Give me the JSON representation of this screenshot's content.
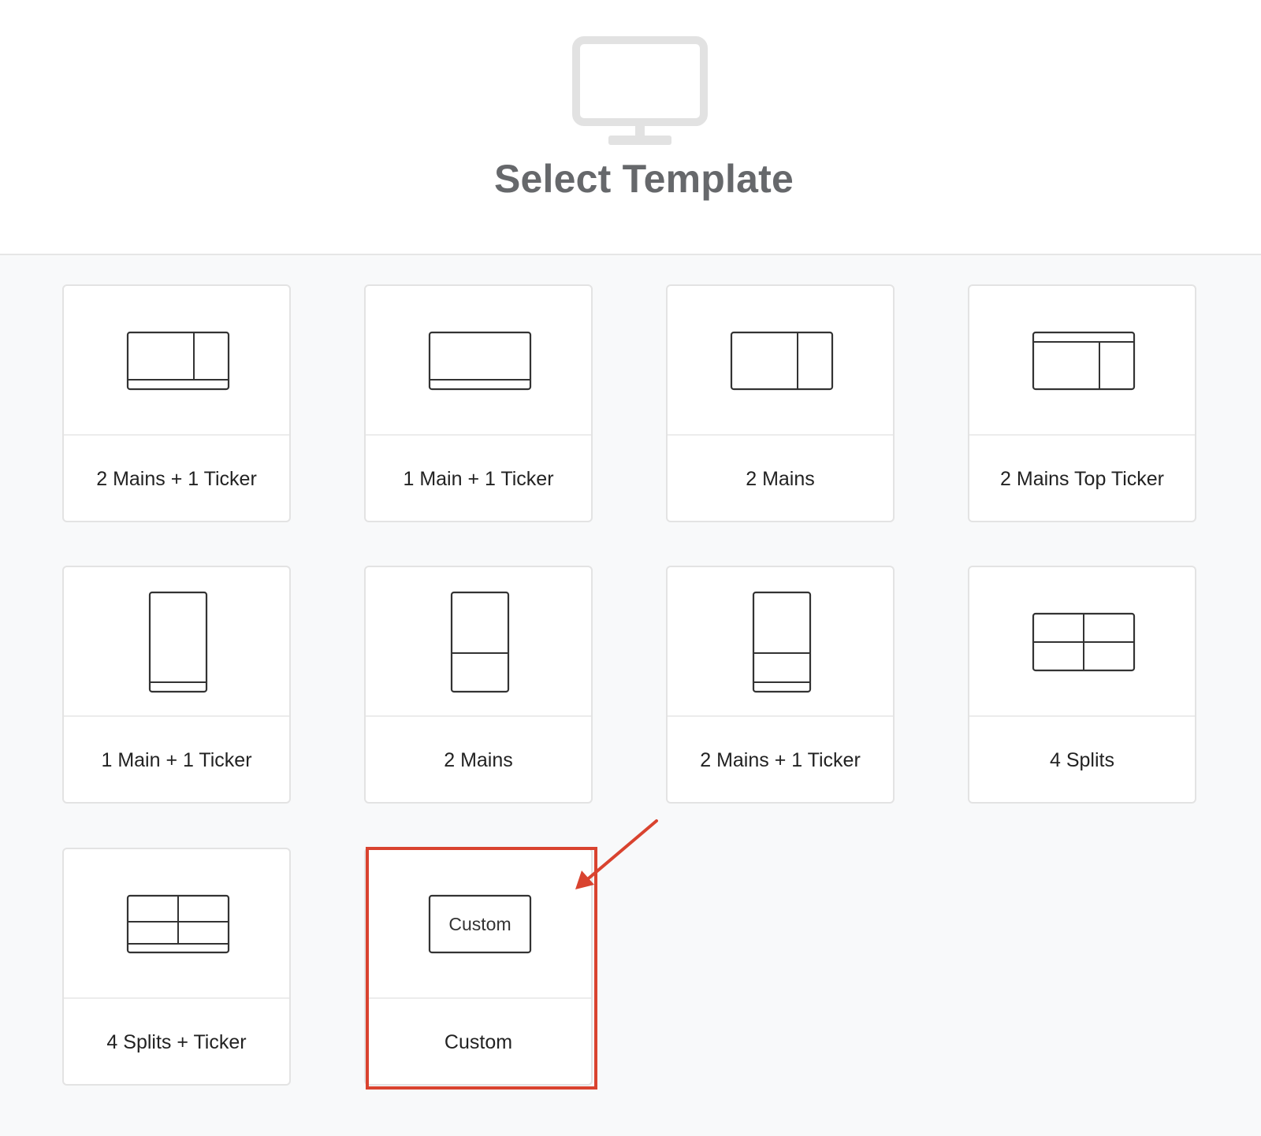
{
  "header": {
    "title": "Select Template",
    "icon": "monitor-icon"
  },
  "templates": [
    {
      "label": "2 Mains + 1 Ticker",
      "icon": "layout-2mains-ticker-landscape-icon"
    },
    {
      "label": "1 Main + 1 Ticker",
      "icon": "layout-1main-ticker-landscape-icon"
    },
    {
      "label": "2 Mains",
      "icon": "layout-2mains-landscape-icon"
    },
    {
      "label": "2 Mains Top Ticker",
      "icon": "layout-2mains-top-ticker-icon"
    },
    {
      "label": "1 Main + 1 Ticker",
      "icon": "layout-1main-ticker-portrait-icon"
    },
    {
      "label": "2 Mains",
      "icon": "layout-2mains-portrait-icon"
    },
    {
      "label": "2 Mains + 1 Ticker",
      "icon": "layout-2mains-ticker-portrait-icon"
    },
    {
      "label": "4 Splits",
      "icon": "layout-4splits-icon"
    },
    {
      "label": "4 Splits + Ticker",
      "icon": "layout-4splits-ticker-icon"
    },
    {
      "label": "Custom",
      "icon": "layout-custom-icon",
      "icon_text": "Custom",
      "highlighted": true
    }
  ],
  "annotation": {
    "highlight_color": "#d9432f"
  }
}
